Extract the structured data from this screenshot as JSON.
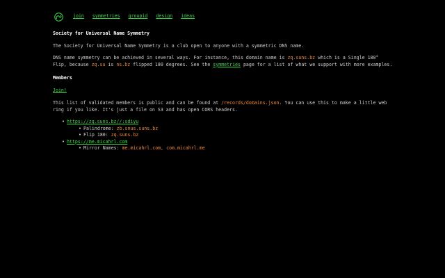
{
  "nav": {
    "logo_icon": "yin-yang-swirl-icon",
    "links": [
      "join",
      "symmetries",
      "groupid",
      "design",
      "ideas"
    ]
  },
  "title": "Society for Universal Name Symmetry",
  "intro": "The Society for Universal Name Symmetry is a club open to anyone with a symmetric DNS name.",
  "para2": {
    "t1": "DNS name symmetry can be achieved in several ways. For instance, this domain name is ",
    "domain": "zq.suns.bz",
    "t2": " which is a Single 180° Flip, because ",
    "a": "zq.su",
    "t3": " is ",
    "b": "ns.bz",
    "t4": " flipped 180 degrees. See the ",
    "link": "symmetries",
    "t5": " page for a list of what we support with more examples."
  },
  "members_heading": "Members",
  "join_link": "Join!",
  "para3": {
    "t1": "This list of validated members is public and can be found at ",
    "path": "/records/domains.json",
    "t2": ". You can use this to make a little web ring if you like. It's just a file on S3 and has open CORS headers."
  },
  "members": [
    {
      "url": "https://zq.suns.bz//:sdiyu",
      "details": [
        {
          "label": "Palindrome: ",
          "value": "zb.snus.suns.bz"
        },
        {
          "label": "Flip 180: ",
          "value": "zq.suns.bz"
        }
      ]
    },
    {
      "url": "https://me.micahrl.com",
      "details": [
        {
          "label": "Mirror Names: ",
          "value": "me.micahrl.com, com.micahrl.me"
        }
      ]
    }
  ],
  "colors": {
    "background": "#000000",
    "link": "#3fdc4a",
    "code": "#f08a3c",
    "text": "#cfcfcf"
  }
}
